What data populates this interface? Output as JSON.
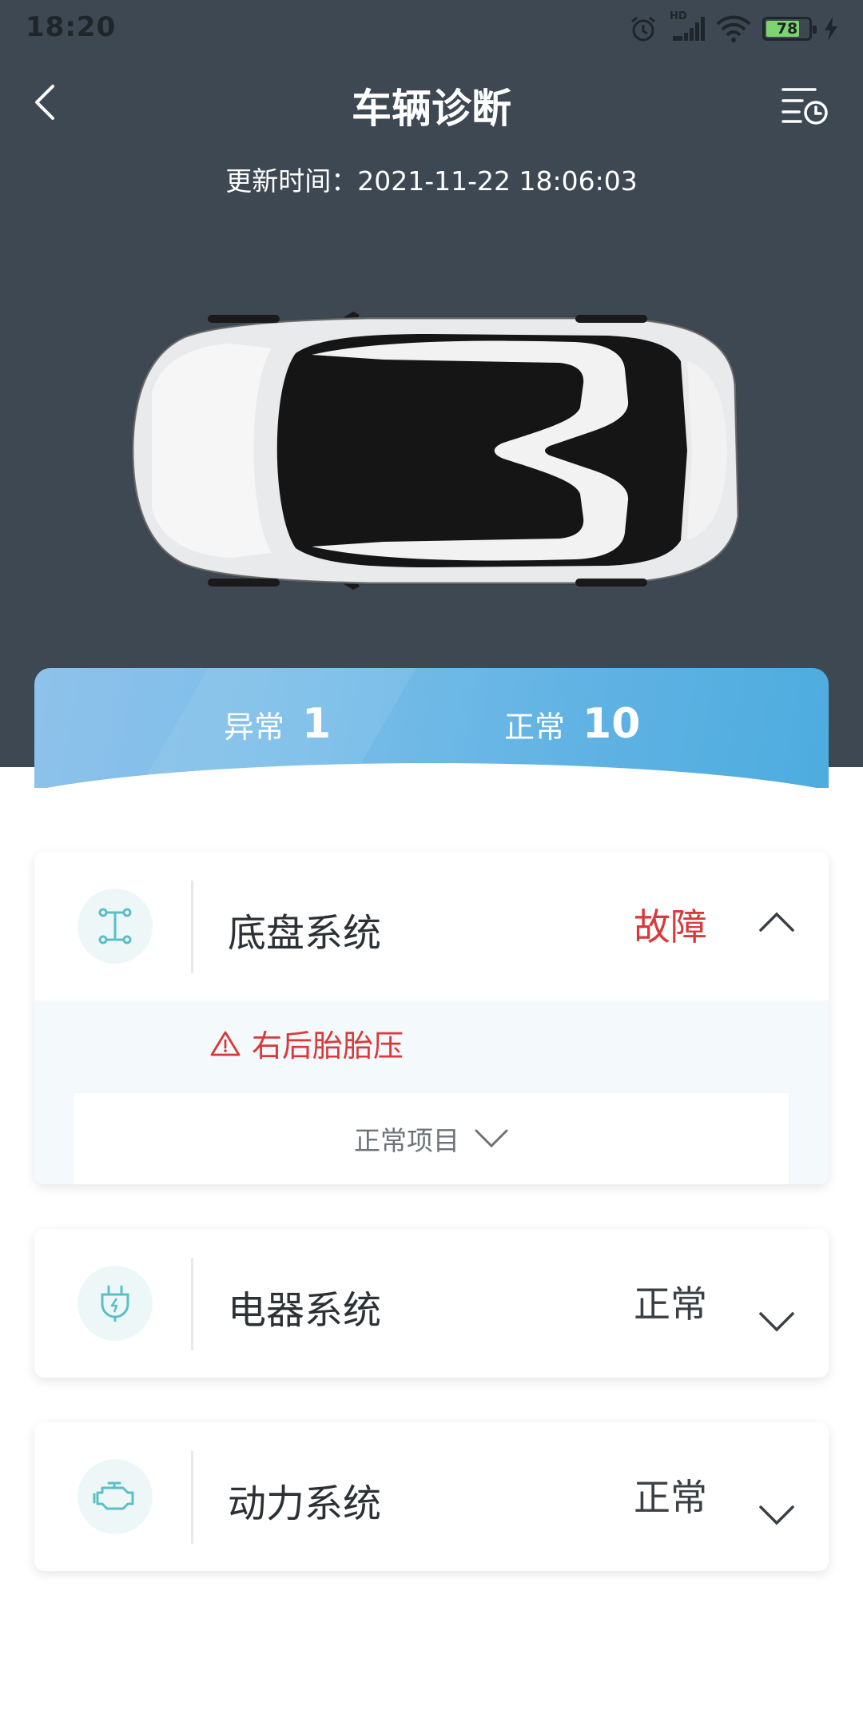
{
  "status_bar": {
    "time": "18:20",
    "battery": "78",
    "battery_level": 0.78,
    "network_label": "HD"
  },
  "header": {
    "title": "车辆诊断",
    "update_label": "更新时间：2021-11-22 18:06:03"
  },
  "summary": {
    "abnormal_label": "异常",
    "abnormal_count": "1",
    "normal_label": "正常",
    "normal_count": "10"
  },
  "systems": [
    {
      "name": "底盘系统",
      "status": "故障",
      "expanded": true,
      "icon": "chassis-icon",
      "faults": [
        "右后胎胎压"
      ],
      "normal_items_label": "正常项目"
    },
    {
      "name": "电器系统",
      "status": "正常",
      "expanded": false,
      "icon": "electrical-plug-icon"
    },
    {
      "name": "动力系统",
      "status": "正常",
      "expanded": false,
      "icon": "engine-icon"
    }
  ],
  "colors": {
    "header_bg": "#3d4852",
    "fault": "#d8393b",
    "accent": "#5fb2e3",
    "icon_teal": "#5bbfc7"
  }
}
